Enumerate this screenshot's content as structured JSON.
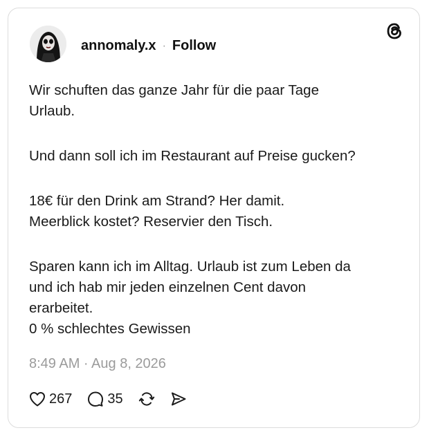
{
  "post": {
    "username": "annomaly.x",
    "separator": "·",
    "follow_label": "Follow",
    "paragraphs": [
      [
        "Wir schuften das ganze Jahr für die paar Tage",
        "Urlaub."
      ],
      [
        "Und dann soll ich im Restaurant auf Preise gucken?"
      ],
      [
        "18€ für den Drink am Strand? Her damit.",
        "Meerblick kostet? Reservier den Tisch."
      ],
      [
        "Sparen kann ich im Alltag. Urlaub ist zum Leben da",
        "und ich hab mir jeden einzelnen Cent davon",
        "erarbeitet.",
        "0 % schlechtes Gewissen"
      ]
    ],
    "timestamp": "8:49 AM · Aug 8, 2026",
    "likes": "267",
    "replies": "35"
  },
  "icons": {
    "logo": "threads-logo-icon",
    "like": "heart-icon",
    "reply": "speech-bubble-icon",
    "repost": "repost-icon",
    "share": "send-icon"
  },
  "colors": {
    "text": "#1a1a1a",
    "muted": "#9b9b9b",
    "border": "#dcdcdc"
  }
}
